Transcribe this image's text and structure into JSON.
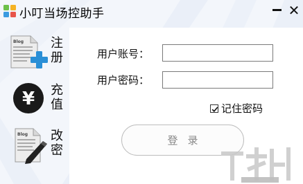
{
  "window": {
    "title": "小叮当场控助手"
  },
  "nav": {
    "items": [
      {
        "label": "注册",
        "icon": "document-plus-icon"
      },
      {
        "label": "充值",
        "icon": "yen-icon"
      },
      {
        "label": "改密",
        "icon": "document-pen-icon"
      }
    ]
  },
  "login": {
    "account_label": "用户账号：",
    "account_value": "",
    "password_label": "用户密码：",
    "password_value": "",
    "remember_label": "记住密码",
    "remember_checked": true,
    "submit_label": "登录"
  },
  "colors": {
    "accent_blue": "#2a8fd6",
    "window_bg": "#f3f6fb",
    "panel_bg": "#ffffff"
  }
}
